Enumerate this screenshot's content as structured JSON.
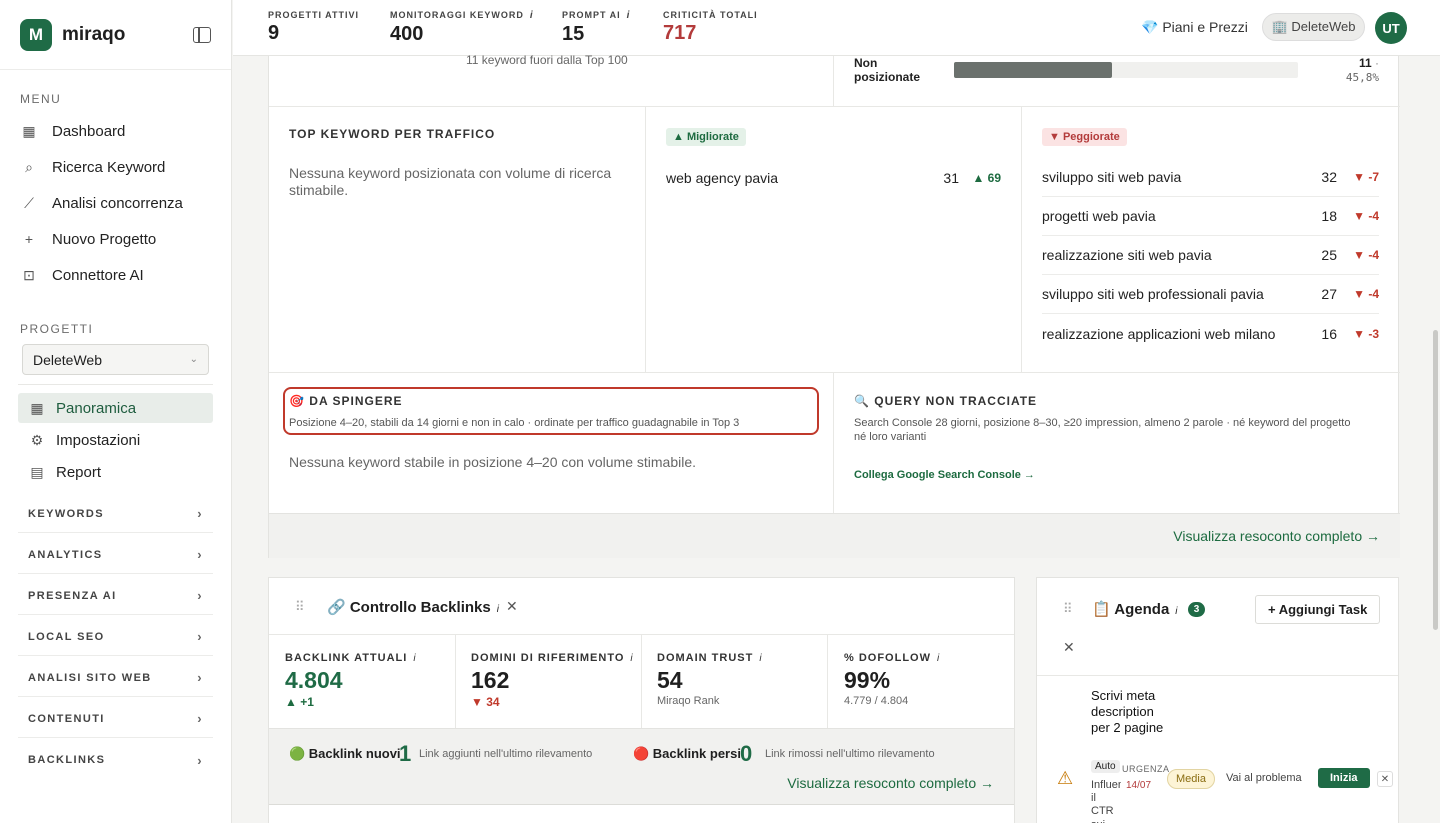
{
  "brand": {
    "name": "miraqo",
    "mark": "M"
  },
  "sidebar": {
    "menu_label": "MENU",
    "menu": [
      {
        "label": "Dashboard",
        "icon": "grid-icon"
      },
      {
        "label": "Ricerca Keyword",
        "icon": "search-icon"
      },
      {
        "label": "Analisi concorrenza",
        "icon": "chart-line-icon"
      },
      {
        "label": "Nuovo Progetto",
        "icon": "plus-icon"
      },
      {
        "label": "Connettore AI",
        "icon": "robot-icon"
      }
    ],
    "projects_label": "PROGETTI",
    "project_selected": "DeleteWeb",
    "project_nav": [
      {
        "label": "Panoramica",
        "icon": "grid-icon"
      },
      {
        "label": "Impostazioni",
        "icon": "gear-icon"
      },
      {
        "label": "Report",
        "icon": "document-icon"
      }
    ],
    "groups": [
      "KEYWORDS",
      "ANALYTICS",
      "PRESENZA AI",
      "LOCAL SEO",
      "ANALISI SITO WEB",
      "CONTENUTI",
      "BACKLINKS"
    ]
  },
  "topbar": {
    "stats": [
      {
        "label": "PROGETTI ATTIVI",
        "value": "9",
        "info": false
      },
      {
        "label": "MONITORAGGI KEYWORD",
        "value": "400",
        "info": true
      },
      {
        "label": "PROMPT AI",
        "value": "15",
        "info": true
      },
      {
        "label": "CRITICITÀ TOTALI",
        "value": "717",
        "info": false
      }
    ],
    "info_glyph": "i",
    "plans": "💎 Piani e Prezzi",
    "workspace": "🏢 DeleteWeb",
    "avatar": "UT"
  },
  "overview": {
    "top_note": "11 keyword fuori dalla Top 100",
    "non_pos_label": "Non posizionate",
    "non_pos_count": "11",
    "non_pos_dot": "·",
    "non_pos_pct": "45,8%",
    "non_pos_fraction": 0.458,
    "traffic": {
      "title": "TOP KEYWORD PER TRAFFICO",
      "empty": "Nessuna keyword posizionata con volume di ricerca stimabile."
    },
    "improved": {
      "badge": "▲ Migliorate",
      "rows": [
        {
          "kw": "web agency pavia",
          "pos": "31",
          "delta": "▲ 69"
        }
      ]
    },
    "worsened": {
      "badge": "▼ Peggiorate",
      "rows": [
        {
          "kw": "sviluppo siti web pavia",
          "pos": "32",
          "delta": "▼ -7"
        },
        {
          "kw": "progetti web pavia",
          "pos": "18",
          "delta": "▼ -4"
        },
        {
          "kw": "realizzazione siti web pavia",
          "pos": "25",
          "delta": "▼ -4"
        },
        {
          "kw": "sviluppo siti web professionali pavia",
          "pos": "27",
          "delta": "▼ -4"
        },
        {
          "kw": "realizzazione applicazioni web milano",
          "pos": "16",
          "delta": "▼ -3"
        }
      ]
    },
    "push": {
      "title": "🎯 DA SPINGERE",
      "desc": "Posizione 4–20, stabili da 14 giorni e non in calo · ordinate per traffico guadagnabile in Top 3",
      "empty": "Nessuna keyword stabile in posizione 4–20 con volume stimabile."
    },
    "query": {
      "title": "🔍 QUERY NON TRACCIATE",
      "desc": "Search Console 28 giorni, posizione 8–30, ≥20 impression, almeno 2 parole · né keyword del progetto né loro varianti",
      "link": "Collega Google Search Console →"
    },
    "full_report": "Visualizza resoconto completo →"
  },
  "backlinks": {
    "drag_glyph": "⠿",
    "title": "🔗 Controllo Backlinks",
    "close_glyph": "✕",
    "kpis": [
      {
        "label": "BACKLINK ATTUALI",
        "value": "4.804",
        "sub": "▲ +1",
        "tone": "green"
      },
      {
        "label": "DOMINI DI RIFERIMENTO",
        "value": "162",
        "sub": "▼ 34",
        "tone": "red"
      },
      {
        "label": "DOMAIN TRUST",
        "value": "54",
        "sub": "Miraqo Rank",
        "tone": "plain"
      },
      {
        "label": "% DOFOLLOW",
        "value": "99%",
        "sub": "4.779 / 4.804",
        "tone": "plain"
      }
    ],
    "new_label": "🟢 Backlink nuovi",
    "new_count": "1",
    "new_desc": "Link aggiunti nell'ultimo rilevamento",
    "lost_label": "🔴 Backlink persi",
    "lost_count": "0",
    "lost_desc": "Link rimossi nell'ultimo rilevamento",
    "full_report": "Visualizza resoconto completo →"
  },
  "agenda": {
    "drag_glyph": "⠿",
    "title": "📋 Agenda",
    "count": "3",
    "add": "+ Aggiungi Task",
    "close_glyph": "✕",
    "task": {
      "title": "Scrivi meta description per 2 pagine",
      "source": "Auto",
      "urgency": "URGENZA",
      "date": "14/07",
      "body": "Influenza il CTR sui...",
      "priority": "Media",
      "link": "Vai al problema",
      "start": "Inizia",
      "dismiss": "✕"
    }
  }
}
